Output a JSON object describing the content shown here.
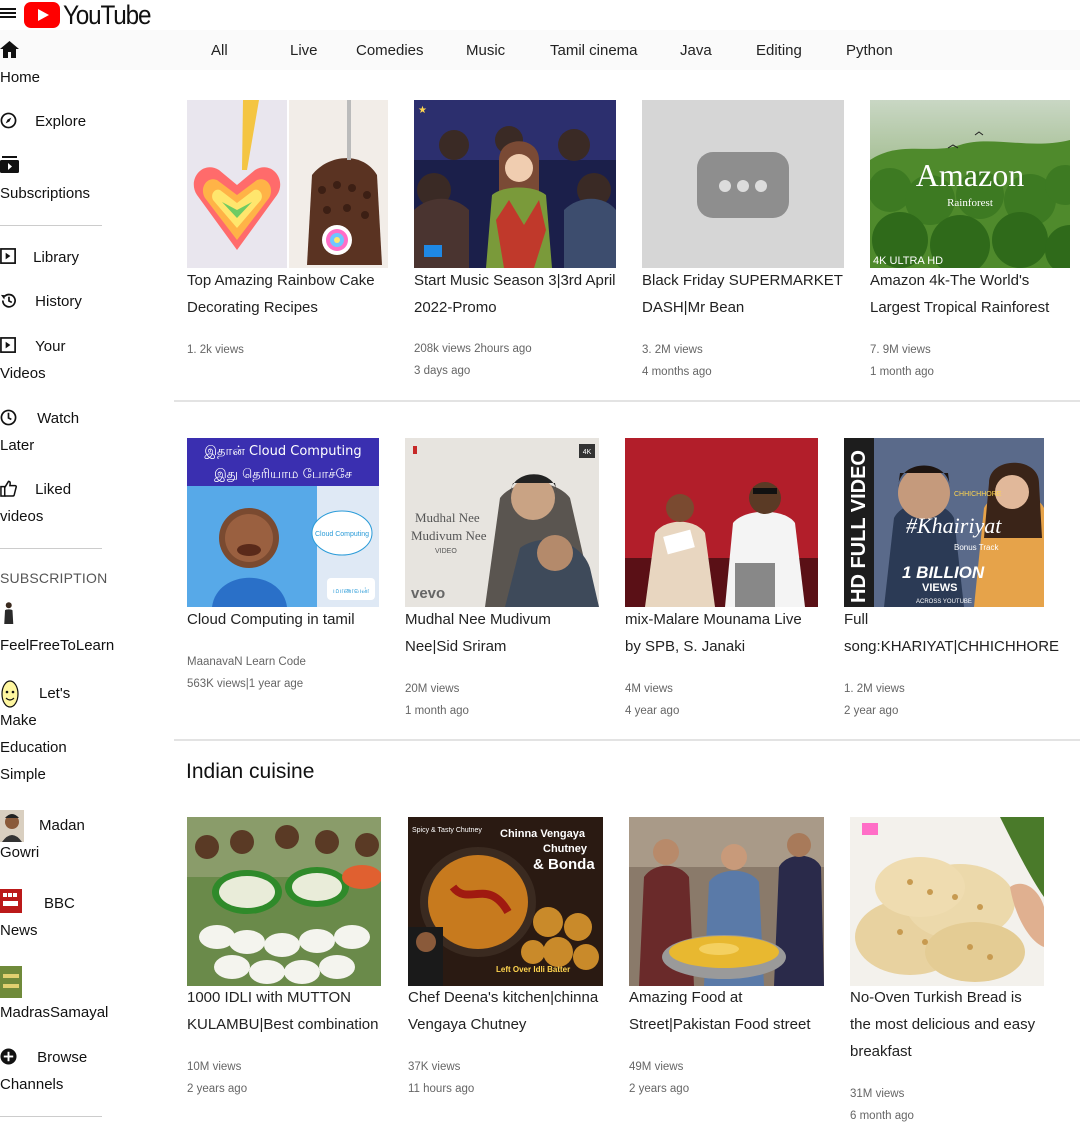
{
  "header": {
    "logo_text": "YouTube",
    "brand_color": "#ff0000"
  },
  "chips": [
    "All",
    "Live",
    "Comedies",
    "Music",
    "Tamil cinema",
    "Java",
    "Editing",
    "Python"
  ],
  "sidebar": {
    "home": "Home",
    "explore": "Explore",
    "subscriptions": "Subscriptions",
    "library": "Library",
    "history": "History",
    "your_videos_1": "Your",
    "your_videos_2": "Videos",
    "watch_later_1": "Watch",
    "watch_later_2": "Later",
    "liked_1": "Liked",
    "liked_2": "videos",
    "subscription_header": "SUBSCRIPTION",
    "channels": {
      "feelfree": "FeelFreeToLearn",
      "lets_1": "Let's",
      "lets_2": "Make",
      "lets_3": "Education",
      "lets_4": "Simple",
      "madan_1": "Madan",
      "madan_2": "Gowri",
      "bbc_1": "BBC",
      "bbc_2": "News",
      "madras": "MadrasSamayal"
    },
    "browse_1": "Browse",
    "browse_2": "Channels"
  },
  "section_title": "Indian cuisine",
  "videos": [
    {
      "title_1": "Top Amazing Rainbow Cake",
      "title_2": "Decorating Recipes",
      "meta_1": "1. 2k views",
      "meta_2": ""
    },
    {
      "title_1": "Start Music Season 3|3rd April",
      "title_2": "2022-Promo",
      "meta_1": "208k views 2hours ago",
      "meta_2": "3 days ago"
    },
    {
      "title_1": "Black Friday SUPERMARKET",
      "title_2": "DASH|Mr Bean",
      "meta_1": "3. 2M views",
      "meta_2": "4 months ago"
    },
    {
      "title_1": "Amazon 4k-The World's",
      "title_2": "Largest Tropical Rainforest",
      "meta_1": "7. 9M views",
      "meta_2": "1 month ago",
      "thumb_title": "Amazon",
      "thumb_sub": "Rainforest",
      "thumb_badge": "4K ULTRA HD"
    },
    {
      "title_1": "Cloud Computing in tamil",
      "title_2": "",
      "meta_1": "MaanavaN Learn Code",
      "meta_2": "563K views|1 year age",
      "thumb_line1": "இதான் Cloud Computing",
      "thumb_line2": "இது தெரியாம போச்சே",
      "thumb_cloud": "Cloud Computing",
      "thumb_logo": "மாணவன்"
    },
    {
      "title_1": "Mudhal Nee Mudivum",
      "title_2": "Nee|Sid Sriram",
      "meta_1": "20M views",
      "meta_2": "1 month ago",
      "thumb_t1": "Mudhal Nee",
      "thumb_t2": "Mudivum Nee",
      "thumb_t3": "VIDEO",
      "thumb_badge": "4K",
      "thumb_vevo": "vevo"
    },
    {
      "title_1": "mix-Malare Mounama Live",
      "title_2": "by SPB, S. Janaki",
      "meta_1": "4M views",
      "meta_2": "4 year ago"
    },
    {
      "title_1": "Full",
      "title_2": "song:KHARIYAT|CHHICHHORE",
      "meta_1": "1. 2M views",
      "meta_2": "2 year ago",
      "thumb_vertical": "HD FULL VIDEO",
      "thumb_script": "#Khairiyat",
      "thumb_bonus": "Bonus Track",
      "thumb_billion": "1 BILLION",
      "thumb_views": "VIEWS",
      "thumb_across": "ACROSS YOUTUBE",
      "thumb_movie": "CHHICHHORE"
    },
    {
      "title_1": "1000 IDLI with MUTTON",
      "title_2": "KULAMBU|Best combination",
      "meta_1": "10M views",
      "meta_2": "2 years ago"
    },
    {
      "title_1": "Chef Deena's kitchen|chinna",
      "title_2": "Vengaya Chutney",
      "meta_1": "37K views",
      "meta_2": "11 hours ago",
      "thumb_t1": "Chinna Vengaya",
      "thumb_t2": "Chutney",
      "thumb_t3": "& Bonda",
      "thumb_left": "Spicy & Tasty Chutney",
      "thumb_leftover": "Left Over Idli Batter"
    },
    {
      "title_1": "Amazing Food at",
      "title_2": "Street|Pakistan Food street",
      "meta_1": "49M views",
      "meta_2": "2 years ago"
    },
    {
      "title_1": "No-Oven Turkish Bread is",
      "title_2": "the most delicious and easy",
      "title_3": "breakfast",
      "meta_1": "31M views",
      "meta_2": "6 month ago"
    }
  ]
}
